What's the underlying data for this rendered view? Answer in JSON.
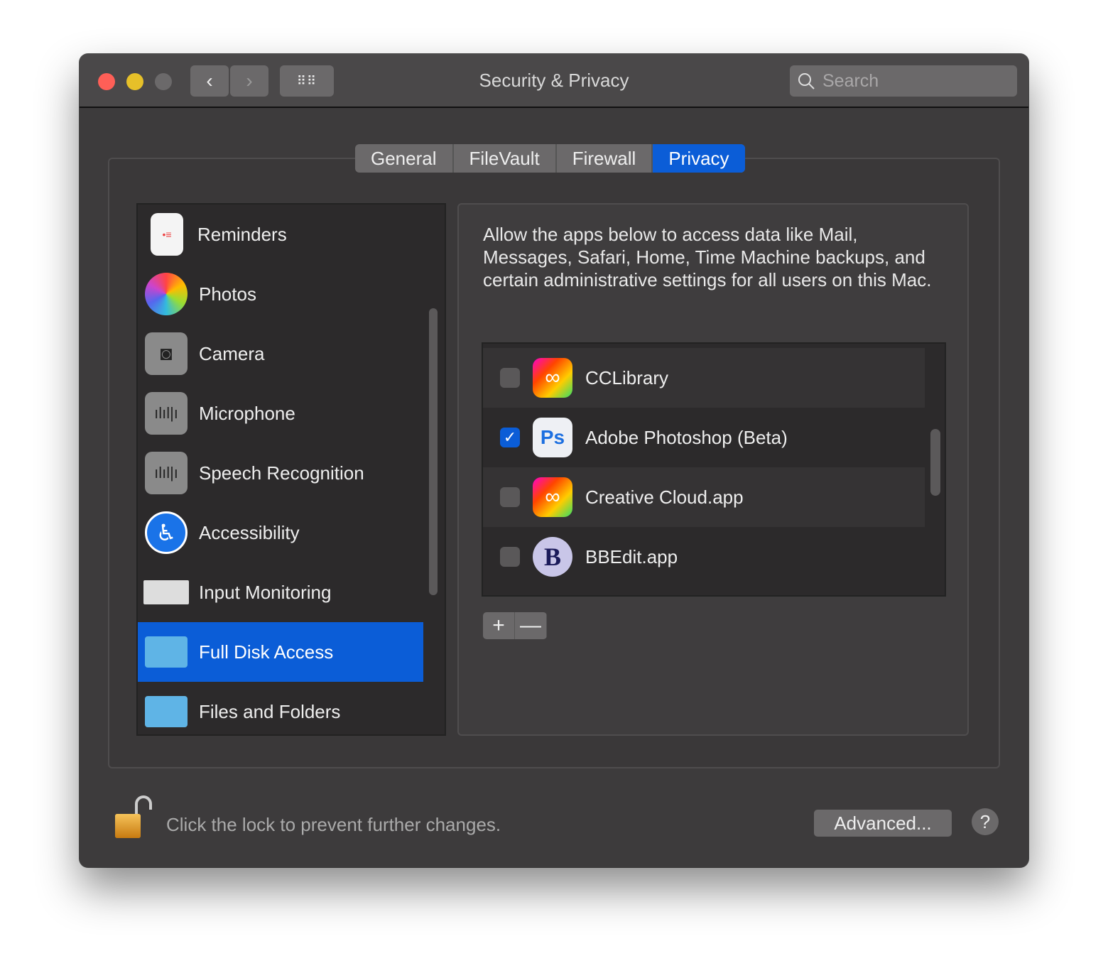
{
  "window": {
    "title": "Security & Privacy",
    "search_placeholder": "Search"
  },
  "tabs": [
    {
      "label": "General"
    },
    {
      "label": "FileVault"
    },
    {
      "label": "Firewall"
    },
    {
      "label": "Privacy",
      "selected": true
    }
  ],
  "sidebar": {
    "items": [
      {
        "label": "Reminders",
        "icon": "reminders-icon"
      },
      {
        "label": "Photos",
        "icon": "photos-icon"
      },
      {
        "label": "Camera",
        "icon": "camera-icon"
      },
      {
        "label": "Microphone",
        "icon": "microphone-icon"
      },
      {
        "label": "Speech Recognition",
        "icon": "speech-icon"
      },
      {
        "label": "Accessibility",
        "icon": "accessibility-icon"
      },
      {
        "label": "Input Monitoring",
        "icon": "keyboard-icon"
      },
      {
        "label": "Full Disk Access",
        "icon": "folder-icon",
        "selected": true
      },
      {
        "label": "Files and Folders",
        "icon": "folder-icon"
      }
    ]
  },
  "main": {
    "description": "Allow the apps below to access data like Mail, Messages, Safari, Home, Time Machine backups, and certain administrative settings for all users on this Mac.",
    "apps": [
      {
        "name": "CCLibrary",
        "checked": false
      },
      {
        "name": "Adobe Photoshop (Beta)",
        "checked": true
      },
      {
        "name": "Creative Cloud.app",
        "checked": false
      },
      {
        "name": "BBEdit.app",
        "checked": false
      }
    ],
    "add_label": "+",
    "remove_label": "—"
  },
  "footer": {
    "lock_text": "Click the lock to prevent further changes.",
    "advanced_label": "Advanced...",
    "help_label": "?"
  },
  "colors": {
    "accent": "#0b5dd7",
    "close": "#fe5f57",
    "minimize": "#e6c029"
  }
}
